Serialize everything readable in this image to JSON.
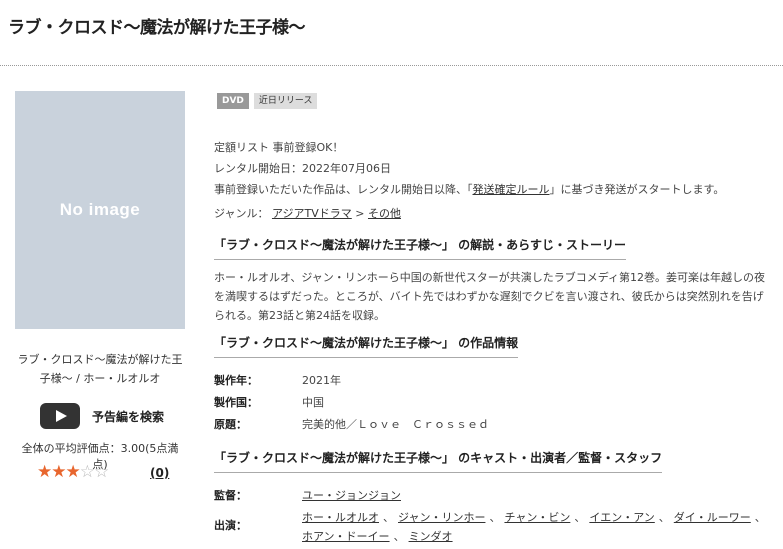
{
  "page_title": "ラブ・クロスド〜魔法が解けた王子様〜",
  "left": {
    "no_image": "No image",
    "caption": "ラブ・クロスド〜魔法が解けた王子様〜 / ホー・ルオルオ",
    "trailer_label": "予告編を検索",
    "avg_rating_text": "全体の平均評価点：3.00(5点満点)",
    "rating": 3,
    "rating_max": 5,
    "review_count": "(0)"
  },
  "badges": [
    "DVD",
    "近日リリース"
  ],
  "meta": {
    "line1": "定額リスト 事前登録OK！",
    "line2": "レンタル開始日：2022年07月06日",
    "line3_pre": "事前登録いただいた作品は、レンタル開始日以降、「",
    "line3_link": "発送確定ルール",
    "line3_post": "」に基づき発送がスタートします。",
    "genre_label": "ジャンル：",
    "genre1": "アジアTVドラマ",
    "genre_sep": ">",
    "genre2": "その他"
  },
  "synopsis": {
    "heading": "「ラブ・クロスド〜魔法が解けた王子様〜」 の解説・あらすじ・ストーリー",
    "text": "ホー・ルオルオ、ジャン・リンホーら中国の新世代スターが共演したラブコメディ第12巻。姜可楽は年越しの夜を満喫するはずだった。ところが、バイト先ではわずかな遅刻でクビを言い渡され、彼氏からは突然別れを告げられる。第23話と第24話を収録。"
  },
  "work_info": {
    "heading": "「ラブ・クロスド〜魔法が解けた王子様〜」 の作品情報",
    "rows": [
      {
        "key": "製作年：",
        "value": "2021年"
      },
      {
        "key": "製作国：",
        "value": "中国"
      },
      {
        "key": "原題：",
        "value": "完美的他／Ｌｏｖｅ　Ｃｒｏｓｓｅｄ"
      }
    ]
  },
  "cast": {
    "heading": "「ラブ・クロスド〜魔法が解けた王子様〜」 のキャスト・出演者／監督・スタッフ",
    "director_label": "監督：",
    "director": "ユー・ジョンジョン",
    "actors_label": "出演：",
    "actors": [
      "ホー・ルオルオ",
      "ジャン・リンホー",
      "チャン・ビン",
      "イエン・アン",
      "ダイ・ルーワー",
      "ホアン・ドーイー",
      "ミンダオ"
    ],
    "sep": "、"
  },
  "colors": {
    "star": "#e8662e",
    "placeholder": "#c9d2dc"
  }
}
